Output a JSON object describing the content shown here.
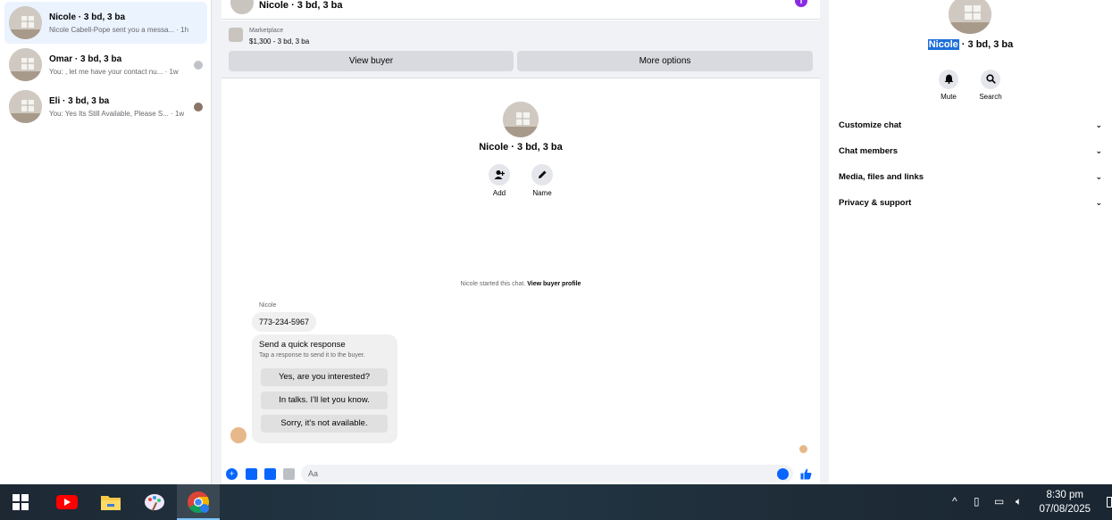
{
  "conversations": [
    {
      "name": "Nicole · 3 bd, 3 ba",
      "snippet": "Nicole Cabell-Pope sent you a messa... · 1h",
      "active": true
    },
    {
      "name": "Omar · 3 bd, 3 ba",
      "snippet": "You: , let me have your contact nu... · 1w",
      "active": false
    },
    {
      "name": "Eli · 3 bd, 3 ba",
      "snippet": "You: Yes Its Still Available, Please S... · 1w",
      "active": false
    }
  ],
  "chat": {
    "title": "Nicole · 3 bd, 3 ba",
    "info_icon": "i",
    "marketplace_label": "Marketplace",
    "listing": "$1,300 - 3 bd, 3 ba",
    "view_buyer": "View buyer",
    "more_options": "More options",
    "profile_name": "Nicole · 3 bd, 3 ba",
    "add_label": "Add",
    "name_label": "Name",
    "started_text": "Nicole started this chat.",
    "view_buyer_profile": "View buyer profile",
    "sender": "Nicole",
    "phone_message": "773-234-5967",
    "quick_title": "Send a quick response",
    "quick_subtitle": "Tap a response to send it to the buyer.",
    "quick_replies": [
      "Yes, are you interested?",
      "In talks. I'll let you know.",
      "Sorry, it's not available."
    ],
    "composer_placeholder": "Aa"
  },
  "details": {
    "name_highlight": "Nicole",
    "name_rest": " · 3 bd, 3 ba",
    "mute_label": "Mute",
    "search_label": "Search",
    "sections": [
      "Customize chat",
      "Chat members",
      "Media, files and links",
      "Privacy & support"
    ]
  },
  "taskbar": {
    "time": "8:30 pm",
    "date": "07/08/2025"
  }
}
